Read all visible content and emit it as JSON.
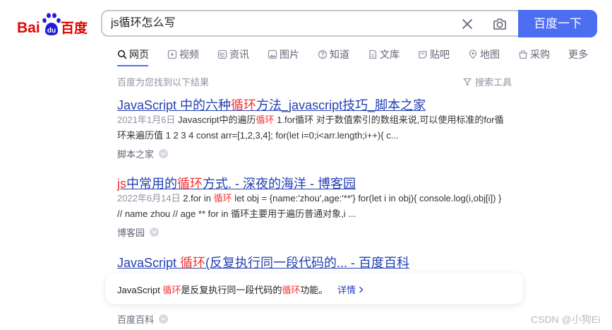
{
  "logo": {
    "text_left": "Bai",
    "text_paw": "du",
    "text_right": "百度"
  },
  "search": {
    "query": "js循环怎么写",
    "button_label": "百度一下"
  },
  "tabs": [
    {
      "label": "网页",
      "icon": "search-icon"
    },
    {
      "label": "视频",
      "icon": "video-icon"
    },
    {
      "label": "资讯",
      "icon": "news-icon"
    },
    {
      "label": "图片",
      "icon": "image-icon"
    },
    {
      "label": "知道",
      "icon": "question-icon"
    },
    {
      "label": "文库",
      "icon": "document-icon"
    },
    {
      "label": "贴吧",
      "icon": "tieba-icon"
    },
    {
      "label": "地图",
      "icon": "map-icon"
    },
    {
      "label": "采购",
      "icon": "shop-icon"
    },
    {
      "label": "更多",
      "icon": ""
    }
  ],
  "result_count": "百度为您找到以下结果",
  "tools_label": "搜索工具",
  "results": [
    {
      "title_a": "JavaScript 中的六种",
      "title_em": "循环",
      "title_b": "方法_javascript技巧_脚本之家",
      "date": "2021年1月6日",
      "snippet_a": "Javascript中的遍历",
      "snippet_em": "循环",
      "snippet_b": " 1.for循环 对于数值索引的数组来说,可以使用标准的for循环来遍历值 1 2 3 4 const arr=[1,2,3,4]; for(let i=0;i<arr.length;i++){ c...",
      "source": "脚本之家"
    },
    {
      "title_pre": "js",
      "title_a": "中常用的",
      "title_em": "循环",
      "title_b": "方式. - 深夜的海洋 - 博客园",
      "date": "2022年6月14日",
      "snippet_a": "2.for in ",
      "snippet_em": "循环",
      "snippet_b": " let obj = {name:'zhou',age:'**'} for(let i in obj){ console.log(i,obj[i]) } // name zhou // age ** for in 循环主要用于遍历普通对象,i ...",
      "source": "博客园"
    },
    {
      "title_a": "JavaScript ",
      "title_em": "循环",
      "title_b": "(反复执行同一段代码的... - 百度百科",
      "card_a": "JavaScript ",
      "card_em1": "循环",
      "card_b": "是反复执行同一段代码的",
      "card_em2": "循环",
      "card_c": "功能。",
      "card_link": "详情",
      "source": "百度百科"
    }
  ],
  "watermark": "CSDN @小狗Ei",
  "colors": {
    "accent": "#4e6ef2",
    "link": "#2440b3",
    "highlight": "#f73131",
    "brand_red": "#e10602",
    "brand_blue": "#2319dc"
  }
}
